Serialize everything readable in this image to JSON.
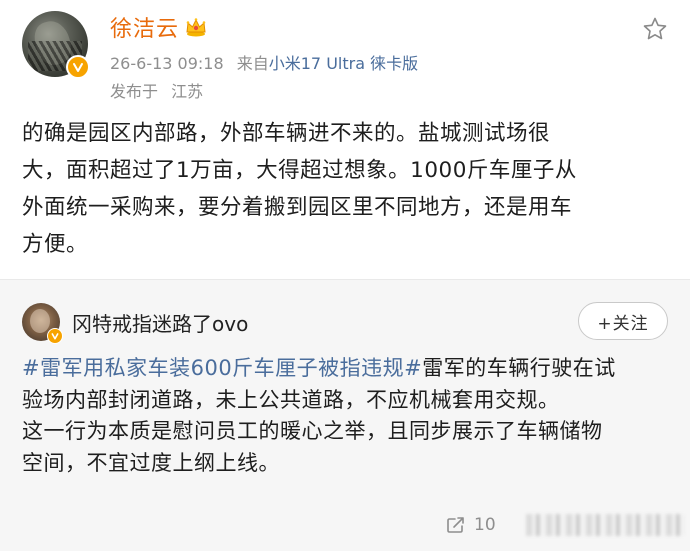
{
  "post": {
    "author": "徐洁云",
    "date": "26-6-13 09:18",
    "from_label": "来自",
    "device": "小米17 Ultra 徕卡版",
    "location_label": "发布于",
    "location": "江苏",
    "lines": [
      "的确是园区内部路，外部车辆进不来的。盐城测试场很",
      "大，面积超过了1万亩，大得超过想象。1000斤车厘子从",
      "外面统一采购来，要分着搬到园区里不同地方，还是用车",
      "方便。"
    ]
  },
  "repost": {
    "author": "冈特戒指迷路了ovo",
    "follow_label": "+关注",
    "hashtag": "#雷军用私家车装600斤车厘子被指违规#",
    "line1_tail": "雷军的车辆行驶在试",
    "lines": [
      "验场内部封闭道路，未上公共道路，不应机械套用交规。",
      "这一行为本质是慰问员工的暖心之举，且同步展示了车辆储物",
      "空间，不宜过度上纲上线。"
    ],
    "repost_count": "10"
  },
  "colors": {
    "author_name": "#e86b0c",
    "link": "#4a6d9c",
    "verified_badge": "#f7a300",
    "repost_background": "#f6f6f6"
  },
  "icons": [
    "avatar",
    "verified-badge-icon",
    "crown-icon",
    "star-icon",
    "repost-icon"
  ]
}
